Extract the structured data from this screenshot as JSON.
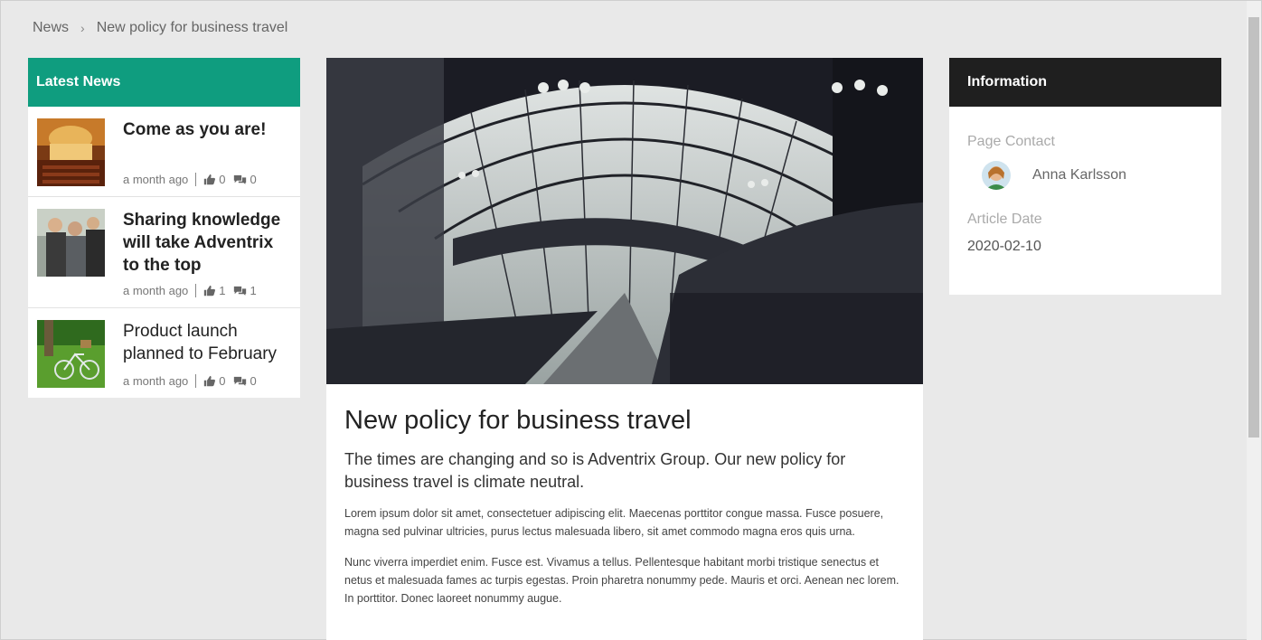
{
  "breadcrumb": {
    "root": "News",
    "separator": "›",
    "current": "New policy for business travel"
  },
  "latest": {
    "header": "Latest News",
    "items": [
      {
        "title": "Come as you are!",
        "time": "a month ago",
        "likes": "0",
        "comments": "0"
      },
      {
        "title": "Sharing knowledge will take Adventrix to the top",
        "time": "a month ago",
        "likes": "1",
        "comments": "1"
      },
      {
        "title": "Product launch planned to February",
        "time": "a month ago",
        "likes": "0",
        "comments": "0"
      }
    ]
  },
  "article": {
    "title": "New policy for business travel",
    "lead": "The times are changing and so is Adventrix Group. Our new policy for business travel is climate neutral.",
    "paragraphs": [
      "Lorem ipsum dolor sit amet, consectetuer adipiscing elit. Maecenas porttitor congue massa. Fusce posuere, magna sed pulvinar ultricies, purus lectus malesuada libero, sit amet commodo magna eros quis urna.",
      "Nunc viverra imperdiet enim. Fusce est. Vivamus a tellus. Pellentesque habitant morbi tristique senectus et netus et malesuada fames ac turpis egestas. Proin pharetra nonummy pede. Mauris et orci. Aenean nec lorem. In porttitor. Donec laoreet nonummy augue."
    ]
  },
  "info": {
    "header": "Information",
    "contact_label": "Page Contact",
    "contact_name": "Anna Karlsson",
    "date_label": "Article Date",
    "date": "2020-02-10"
  },
  "icons": {
    "like": "thumbs-up-icon",
    "comment": "comments-icon"
  },
  "colors": {
    "accent": "#0f9d7f",
    "info_header": "#1f1f1f",
    "background": "#e9e9e9"
  }
}
